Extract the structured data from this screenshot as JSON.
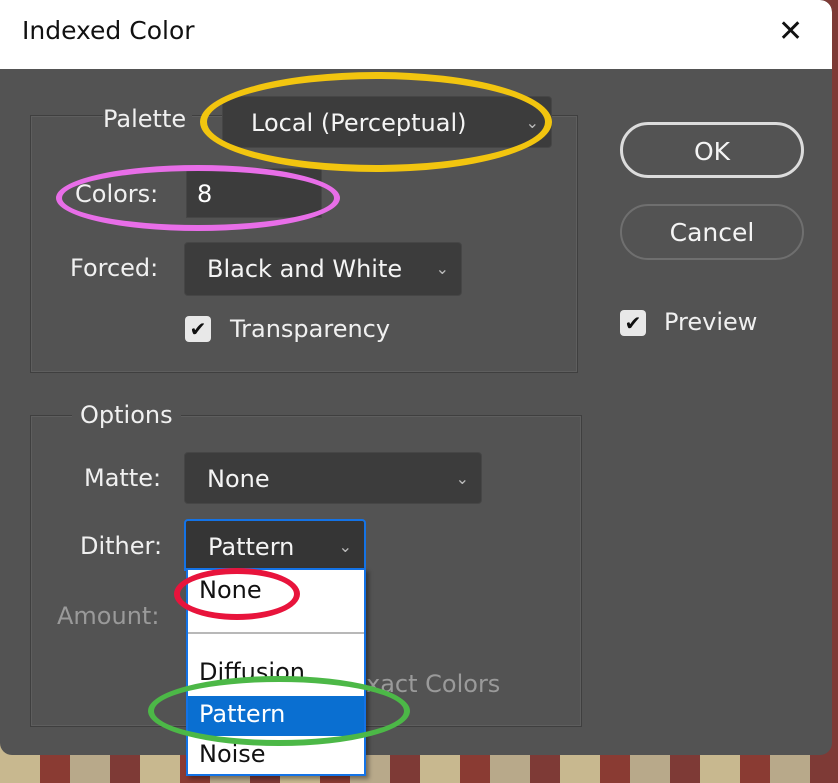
{
  "window": {
    "title": "Indexed Color",
    "close_icon": "close-icon"
  },
  "palette_group": {
    "palette_label": "Palette",
    "palette_value": "Local (Perceptual)",
    "colors_label": "Colors:",
    "colors_value": "8",
    "forced_label": "Forced:",
    "forced_value": "Black and White",
    "transparency_label": "Transparency",
    "transparency_checked": true
  },
  "options_group": {
    "title": "Options",
    "matte_label": "Matte:",
    "matte_value": "None",
    "dither_label": "Dither:",
    "dither_value": "Pattern",
    "amount_label": "Amount:",
    "preserve_label_partial": "xact Colors"
  },
  "dither_dropdown": {
    "items": [
      "None",
      "Diffusion",
      "Pattern",
      "Noise"
    ],
    "selected": "Pattern"
  },
  "buttons": {
    "ok": "OK",
    "cancel": "Cancel"
  },
  "preview": {
    "label": "Preview",
    "checked": true
  },
  "annotations": {
    "palette_highlight_color": "#f2c50f",
    "colors_highlight_color": "#e86ee8",
    "none_highlight_color": "#e8143c",
    "pattern_highlight_color": "#4cb847"
  }
}
